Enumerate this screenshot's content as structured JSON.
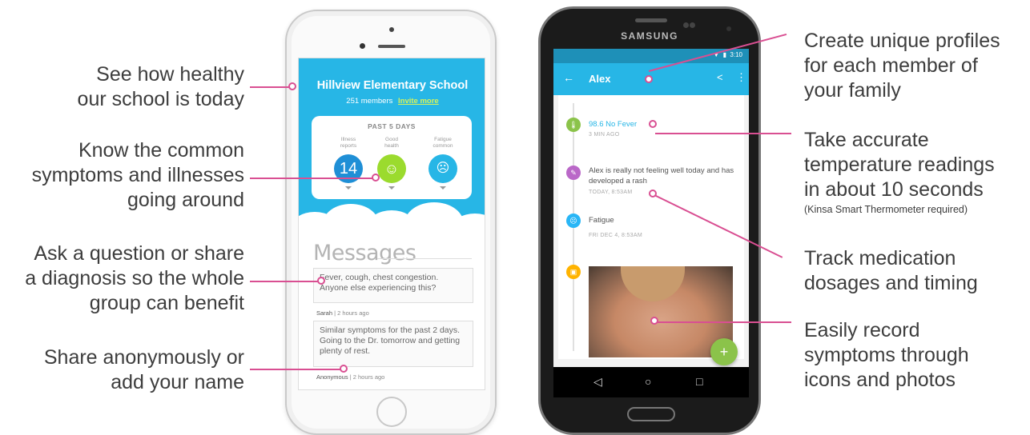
{
  "left_callouts": [
    {
      "lines": [
        "See how healthy",
        "our school is today"
      ]
    },
    {
      "lines": [
        "Know the common",
        "symptoms and illnesses",
        "going around"
      ]
    },
    {
      "lines": [
        "Ask a question or share",
        "a diagnosis so the whole",
        "group can benefit"
      ]
    },
    {
      "lines": [
        "Share anonymously or",
        "add your name"
      ]
    }
  ],
  "right_callouts": [
    {
      "lines": [
        "Create unique profiles",
        "for each member of",
        "your family"
      ]
    },
    {
      "lines": [
        "Take accurate",
        "temperature readings",
        "in about 10 seconds"
      ],
      "note": "(Kinsa Smart Thermometer required)"
    },
    {
      "lines": [
        "Track medication",
        "dosages and timing"
      ]
    },
    {
      "lines": [
        "Easily record",
        "symptoms through",
        "icons and photos"
      ]
    }
  ],
  "iphone": {
    "school": "Hillview Elementary School",
    "members": "251 members",
    "invite": "Invite more",
    "card_title": "PAST 5 DAYS",
    "stats": [
      {
        "label1": "Illness",
        "label2": "reports",
        "value": "14"
      },
      {
        "label1": "Good",
        "label2": "health",
        "value": "☺"
      },
      {
        "label1": "Fatigue",
        "label2": "common",
        "value": "☹"
      }
    ],
    "messages_title": "Messages",
    "messages": [
      {
        "text": "Fever, cough, chest congestion. Anyone else experiencing this?",
        "author": "Sarah",
        "time": "| 2 hours ago"
      },
      {
        "text": "Similar symptoms for the past 2 days. Going to the Dr. tomorrow and getting plenty of rest.",
        "author": "Anonymous",
        "time": "| 2 hours ago"
      }
    ]
  },
  "samsung": {
    "brand": "SAMSUNG",
    "status_time": "3:10",
    "profile_name": "Alex",
    "timeline": [
      {
        "icon": "thermometer-icon",
        "text": "98.6 No Fever",
        "sub": "3 MIN AGO"
      },
      {
        "icon": "pencil-icon",
        "text": "Alex is really not feeling well today and has developed a rash",
        "sub": "TODAY, 8:53AM"
      },
      {
        "icon": "face-icon",
        "text": "Fatigue",
        "sub": "FRI DEC 4, 8:53AM"
      },
      {
        "icon": "camera-icon",
        "text": "",
        "sub": ""
      }
    ],
    "fab": "+"
  },
  "colors": {
    "accent": "#27b6e6",
    "connector": "#d94f92",
    "green": "#8bc34a"
  }
}
